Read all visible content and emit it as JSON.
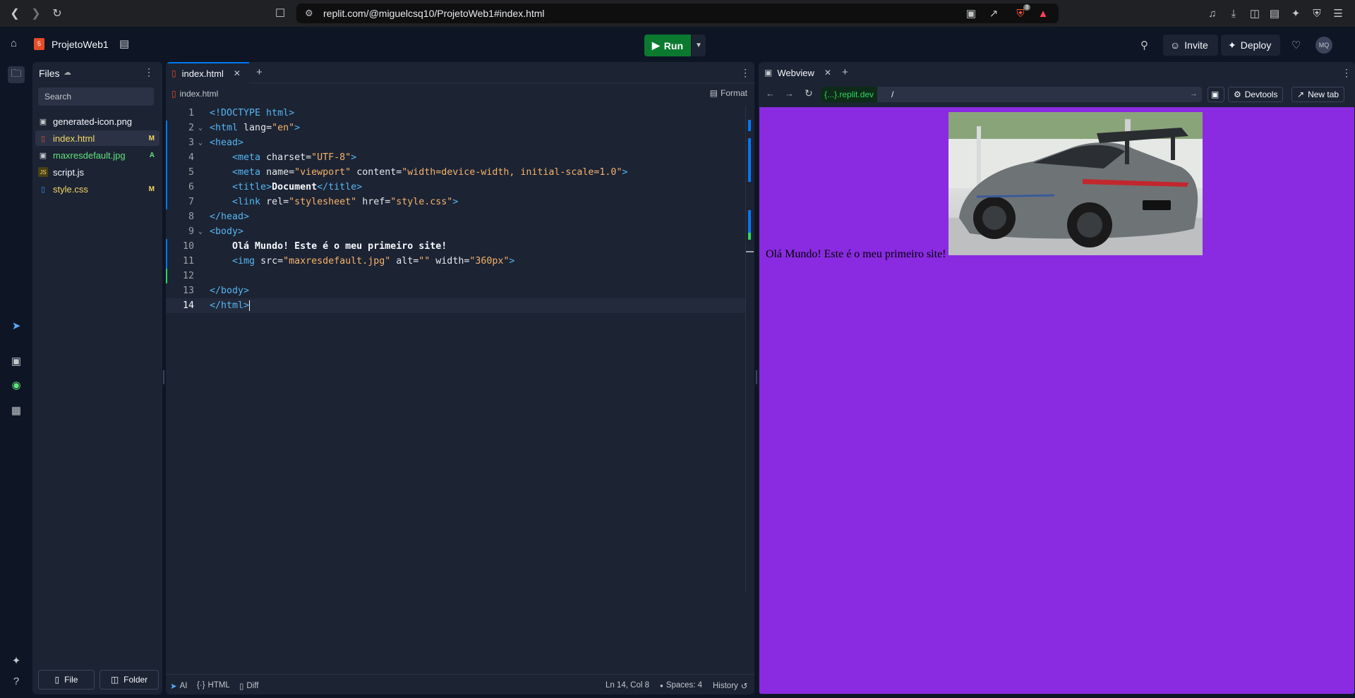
{
  "browser": {
    "url": "replit.com/@miguelcsq10/ProjetoWeb1#index.html",
    "shield_badge": "8"
  },
  "header": {
    "project_name": "ProjetoWeb1",
    "run_label": "Run",
    "invite_label": "Invite",
    "deploy_label": "Deploy",
    "avatar_initials": "MQ"
  },
  "files": {
    "title": "Files",
    "search_placeholder": "Search",
    "items": [
      {
        "name": "generated-icon.png",
        "badge": "",
        "color": "#f5f9fc"
      },
      {
        "name": "index.html",
        "badge": "M",
        "color": "#f5d765"
      },
      {
        "name": "maxresdefault.jpg",
        "badge": "A",
        "color": "#61e27d"
      },
      {
        "name": "script.js",
        "badge": "",
        "color": "#f5f9fc"
      },
      {
        "name": "style.css",
        "badge": "M",
        "color": "#f5d765"
      }
    ],
    "file_button": "File",
    "folder_button": "Folder"
  },
  "editor": {
    "tab_label": "index.html",
    "breadcrumb": "index.html",
    "format_label": "Format",
    "lines": [
      "1",
      "2",
      "3",
      "4",
      "5",
      "6",
      "7",
      "8",
      "9",
      "10",
      "11",
      "12",
      "13",
      "14"
    ],
    "status": {
      "ai": "AI",
      "lang": "HTML",
      "diff": "Diff",
      "position": "Ln 14, Col 8",
      "spaces": "Spaces: 4",
      "history": "History"
    }
  },
  "webview": {
    "tab_label": "Webview",
    "domain": "{...}.replit.dev",
    "path": "/",
    "devtools_label": "Devtools",
    "newtab_label": "New tab",
    "page_text": "Olá Mundo! Este é o meu primeiro site!"
  }
}
